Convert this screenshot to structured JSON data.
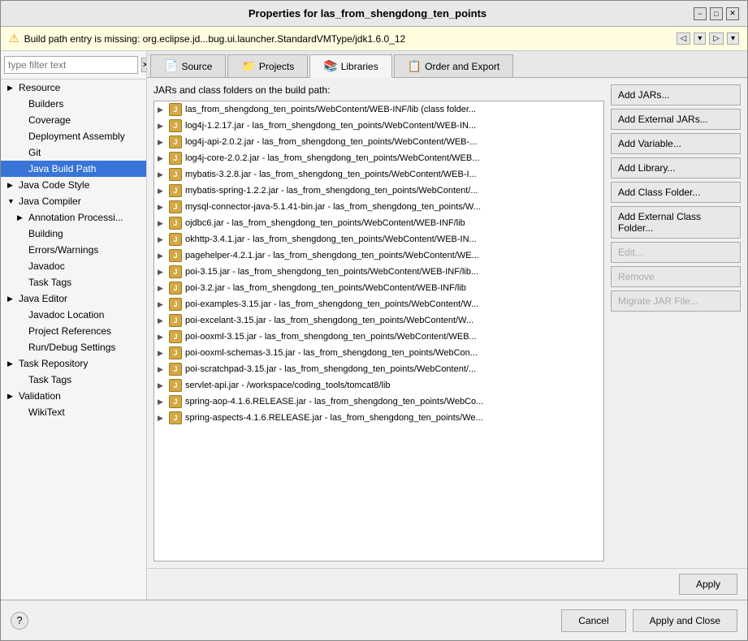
{
  "window": {
    "title": "Properties for las_from_shengdong_ten_points",
    "minimize_label": "−",
    "maximize_label": "□",
    "close_label": "✕"
  },
  "warning": {
    "text": "Build path entry is missing: org.eclipse.jd...bug.ui.launcher.StandardVMType/jdk1.6.0_12",
    "icon": "⚠"
  },
  "filter": {
    "placeholder": "type filter text"
  },
  "sidebar": {
    "items": [
      {
        "id": "resource",
        "label": "Resource",
        "level": 0,
        "expandable": true,
        "selected": false
      },
      {
        "id": "builders",
        "label": "Builders",
        "level": 1,
        "expandable": false,
        "selected": false
      },
      {
        "id": "coverage",
        "label": "Coverage",
        "level": 1,
        "expandable": false,
        "selected": false
      },
      {
        "id": "deployment-assembly",
        "label": "Deployment Assembly",
        "level": 1,
        "expandable": false,
        "selected": false
      },
      {
        "id": "git",
        "label": "Git",
        "level": 1,
        "expandable": false,
        "selected": false
      },
      {
        "id": "java-build-path",
        "label": "Java Build Path",
        "level": 1,
        "expandable": false,
        "selected": true
      },
      {
        "id": "java-code-style",
        "label": "Java Code Style",
        "level": 0,
        "expandable": true,
        "selected": false
      },
      {
        "id": "java-compiler",
        "label": "Java Compiler",
        "level": 0,
        "expandable": false,
        "selected": false
      },
      {
        "id": "annotation-processing",
        "label": "Annotation Processi...",
        "level": 2,
        "expandable": true,
        "selected": false
      },
      {
        "id": "building",
        "label": "Building",
        "level": 2,
        "expandable": false,
        "selected": false
      },
      {
        "id": "errors-warnings",
        "label": "Errors/Warnings",
        "level": 2,
        "expandable": false,
        "selected": false
      },
      {
        "id": "javadoc",
        "label": "Javadoc",
        "level": 2,
        "expandable": false,
        "selected": false
      },
      {
        "id": "task-tags",
        "label": "Task Tags",
        "level": 2,
        "expandable": false,
        "selected": false
      },
      {
        "id": "java-editor",
        "label": "Java Editor",
        "level": 0,
        "expandable": true,
        "selected": false
      },
      {
        "id": "javadoc-location",
        "label": "Javadoc Location",
        "level": 1,
        "expandable": false,
        "selected": false
      },
      {
        "id": "project-references",
        "label": "Project References",
        "level": 1,
        "expandable": false,
        "selected": false
      },
      {
        "id": "run-debug-settings",
        "label": "Run/Debug Settings",
        "level": 1,
        "expandable": false,
        "selected": false
      },
      {
        "id": "task-repository",
        "label": "Task Repository",
        "level": 0,
        "expandable": true,
        "selected": false
      },
      {
        "id": "task-tags2",
        "label": "Task Tags",
        "level": 1,
        "expandable": false,
        "selected": false
      },
      {
        "id": "validation",
        "label": "Validation",
        "level": 0,
        "expandable": true,
        "selected": false
      },
      {
        "id": "wikitext",
        "label": "WikiText",
        "level": 1,
        "expandable": false,
        "selected": false
      }
    ]
  },
  "tabs": [
    {
      "id": "source",
      "label": "Source",
      "icon": "📄",
      "active": false
    },
    {
      "id": "projects",
      "label": "Projects",
      "icon": "📁",
      "active": false
    },
    {
      "id": "libraries",
      "label": "Libraries",
      "icon": "📚",
      "active": true
    },
    {
      "id": "order-export",
      "label": "Order and Export",
      "icon": "📋",
      "active": false
    }
  ],
  "jar_section": {
    "label": "JARs and class folders on the build path:",
    "items": [
      {
        "text": "las_from_shengdong_ten_points/WebContent/WEB-INF/lib (class folder..."
      },
      {
        "text": "log4j-1.2.17.jar - las_from_shengdong_ten_points/WebContent/WEB-IN..."
      },
      {
        "text": "log4j-api-2.0.2.jar - las_from_shengdong_ten_points/WebContent/WEB-..."
      },
      {
        "text": "log4j-core-2.0.2.jar - las_from_shengdong_ten_points/WebContent/WEB..."
      },
      {
        "text": "mybatis-3.2.8.jar - las_from_shengdong_ten_points/WebContent/WEB-I..."
      },
      {
        "text": "mybatis-spring-1.2.2.jar - las_from_shengdong_ten_points/WebContent/..."
      },
      {
        "text": "mysql-connector-java-5.1.41-bin.jar - las_from_shengdong_ten_points/W..."
      },
      {
        "text": "ojdbc6.jar - las_from_shengdong_ten_points/WebContent/WEB-INF/lib"
      },
      {
        "text": "okhttp-3.4.1.jar - las_from_shengdong_ten_points/WebContent/WEB-IN..."
      },
      {
        "text": "pagehelper-4.2.1.jar - las_from_shengdong_ten_points/WebContent/WE..."
      },
      {
        "text": "poi-3.15.jar - las_from_shengdong_ten_points/WebContent/WEB-INF/lib..."
      },
      {
        "text": "poi-3.2.jar - las_from_shengdong_ten_points/WebContent/WEB-INF/lib"
      },
      {
        "text": "poi-examples-3.15.jar - las_from_shengdong_ten_points/WebContent/W..."
      },
      {
        "text": "poi-excelant-3.15.jar - las_from_shengdong_ten_points/WebContent/W..."
      },
      {
        "text": "poi-ooxml-3.15.jar - las_from_shengdong_ten_points/WebContent/WEB..."
      },
      {
        "text": "poi-ooxml-schemas-3.15.jar - las_from_shengdong_ten_points/WebCon..."
      },
      {
        "text": "poi-scratchpad-3.15.jar - las_from_shengdong_ten_points/WebContent/..."
      },
      {
        "text": "servlet-api.jar - /workspace/coding_tools/tomcat8/lib"
      },
      {
        "text": "spring-aop-4.1.6.RELEASE.jar - las_from_shengdong_ten_points/WebCo..."
      },
      {
        "text": "spring-aspects-4.1.6.RELEASE.jar - las_from_shengdong_ten_points/We..."
      }
    ]
  },
  "buttons": {
    "add_jars": "Add JARs...",
    "add_external_jars": "Add External JARs...",
    "add_variable": "Add Variable...",
    "add_library": "Add Library...",
    "add_class_folder": "Add Class Folder...",
    "add_external_class_folder": "Add External Class Folder...",
    "edit": "Edit...",
    "remove": "Remove",
    "migrate_jar": "Migrate JAR File...",
    "apply": "Apply",
    "cancel": "Cancel",
    "apply_and_close": "Apply and Close"
  }
}
